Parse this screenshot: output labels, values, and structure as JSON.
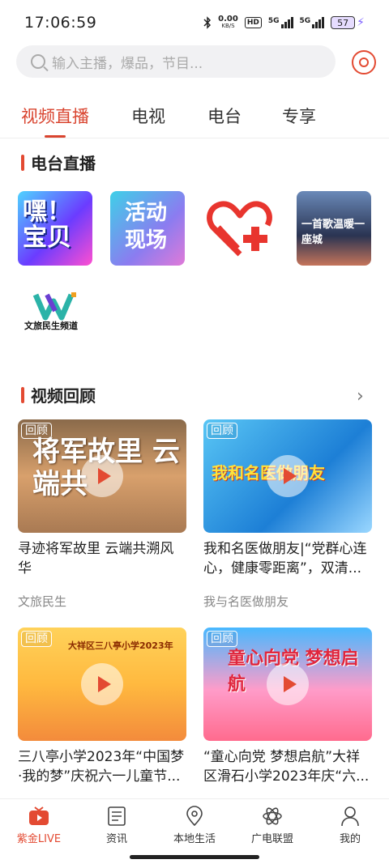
{
  "status": {
    "time": "17:06:59",
    "net_rate": "0.00",
    "net_unit": "KB/S",
    "hd": "HD",
    "sig1": "5G",
    "sig2": "5G",
    "battery": "57"
  },
  "search": {
    "placeholder": "输入主播，爆品，节目..."
  },
  "tabs": [
    {
      "label": "视频直播",
      "active": true
    },
    {
      "label": "电视"
    },
    {
      "label": "电台"
    },
    {
      "label": "专享"
    }
  ],
  "radio": {
    "title": "电台直播",
    "stations": [
      {
        "label": "嘿！宝贝"
      },
      {
        "label": "活动现场"
      },
      {
        "label": ""
      },
      {
        "label": "一首歌温暖一座城"
      },
      {
        "label": "文旅民生频道"
      }
    ]
  },
  "video": {
    "title": "视频回顾",
    "badge": "回顾",
    "cards": [
      {
        "title": "寻迹将军故里 云端共溯风华",
        "sub": "文旅民生",
        "thumb_text": "将军故里 云端共"
      },
      {
        "title": "我和名医做朋友|“党群心连心，健康零距离”，双清...",
        "sub": "我与名医做朋友",
        "thumb_text": "我和名医做朋友"
      },
      {
        "title": "三八亭小学2023年“中国梦·我的梦”庆祝六一儿童节...",
        "sub": "",
        "thumb_text": "大祥区三八亭小学2023年"
      },
      {
        "title": "“童心向党 梦想启航”大祥区滑石小学2023年庆“六...",
        "sub": "",
        "thumb_text": "童心向党 梦想启航"
      }
    ]
  },
  "nav": [
    {
      "label": "紫金LIVE",
      "active": true
    },
    {
      "label": "资讯"
    },
    {
      "label": "本地生活"
    },
    {
      "label": "广电联盟"
    },
    {
      "label": "我的"
    }
  ]
}
